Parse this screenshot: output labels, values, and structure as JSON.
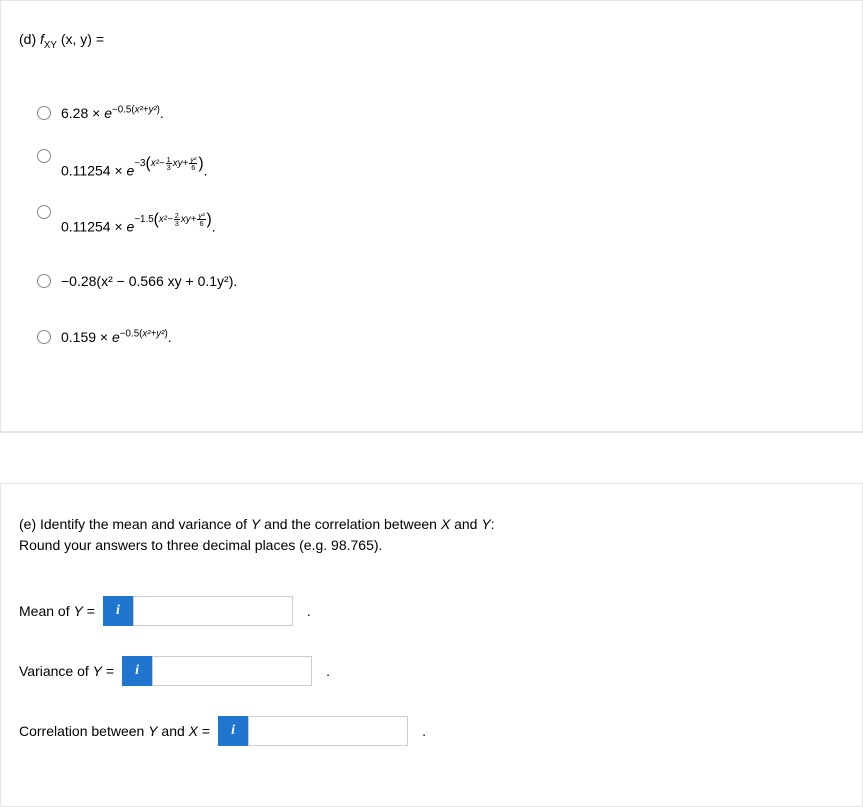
{
  "partD": {
    "label_prefix": "(d) ",
    "func": "f",
    "sub": "XY",
    "args": "(x, y) =",
    "options": {
      "a": {
        "coef": "6.28 × ",
        "e": "e",
        "exp_pre": "−0.5(",
        "exp_in": "x²+y²",
        "exp_post": ")",
        "tail": "."
      },
      "b": {
        "coef": "0.11254 × ",
        "e": "e",
        "minus": "−3",
        "lp": "(",
        "x2": "x²−",
        "frac_num": "1",
        "frac_den": "3",
        "mid": "xy+",
        "frac2_num": "y²",
        "frac2_den": "6",
        "rp": ")",
        "tail": "."
      },
      "c": {
        "coef": "0.11254 × ",
        "e": "e",
        "minus": "−1.5",
        "lp": "(",
        "x2": "x²−",
        "frac_num": "2",
        "frac_den": "3",
        "mid": "xy+",
        "frac2_num": "y²",
        "frac2_den": "6",
        "rp": ")",
        "tail": "."
      },
      "d": {
        "text": "−0.28(x² − 0.566 xy + 0.1y²)."
      },
      "e": {
        "coef": "0.159 × ",
        "e": "e",
        "exp_pre": "−0.5(",
        "exp_in": "x²+y²",
        "exp_post": ")",
        "tail": "."
      }
    }
  },
  "partE": {
    "line1_a": "(e) Identify the mean and variance of ",
    "Y1": "Y",
    "line1_b": " and the correlation between ",
    "X1": "X",
    "line1_c": " and ",
    "Y2": "Y",
    "line1_d": ":",
    "line2": "Round your answers to three decimal places (e.g. 98.765).",
    "mean_label_a": "Mean of ",
    "mean_label_y": "Y",
    "eq": " = ",
    "var_label_a": "Variance of ",
    "var_label_y": "Y",
    "corr_label_a": "Correlation between ",
    "corr_label_y": "Y",
    "corr_label_b": " and ",
    "corr_label_x": "X",
    "info": "i",
    "period": "."
  }
}
